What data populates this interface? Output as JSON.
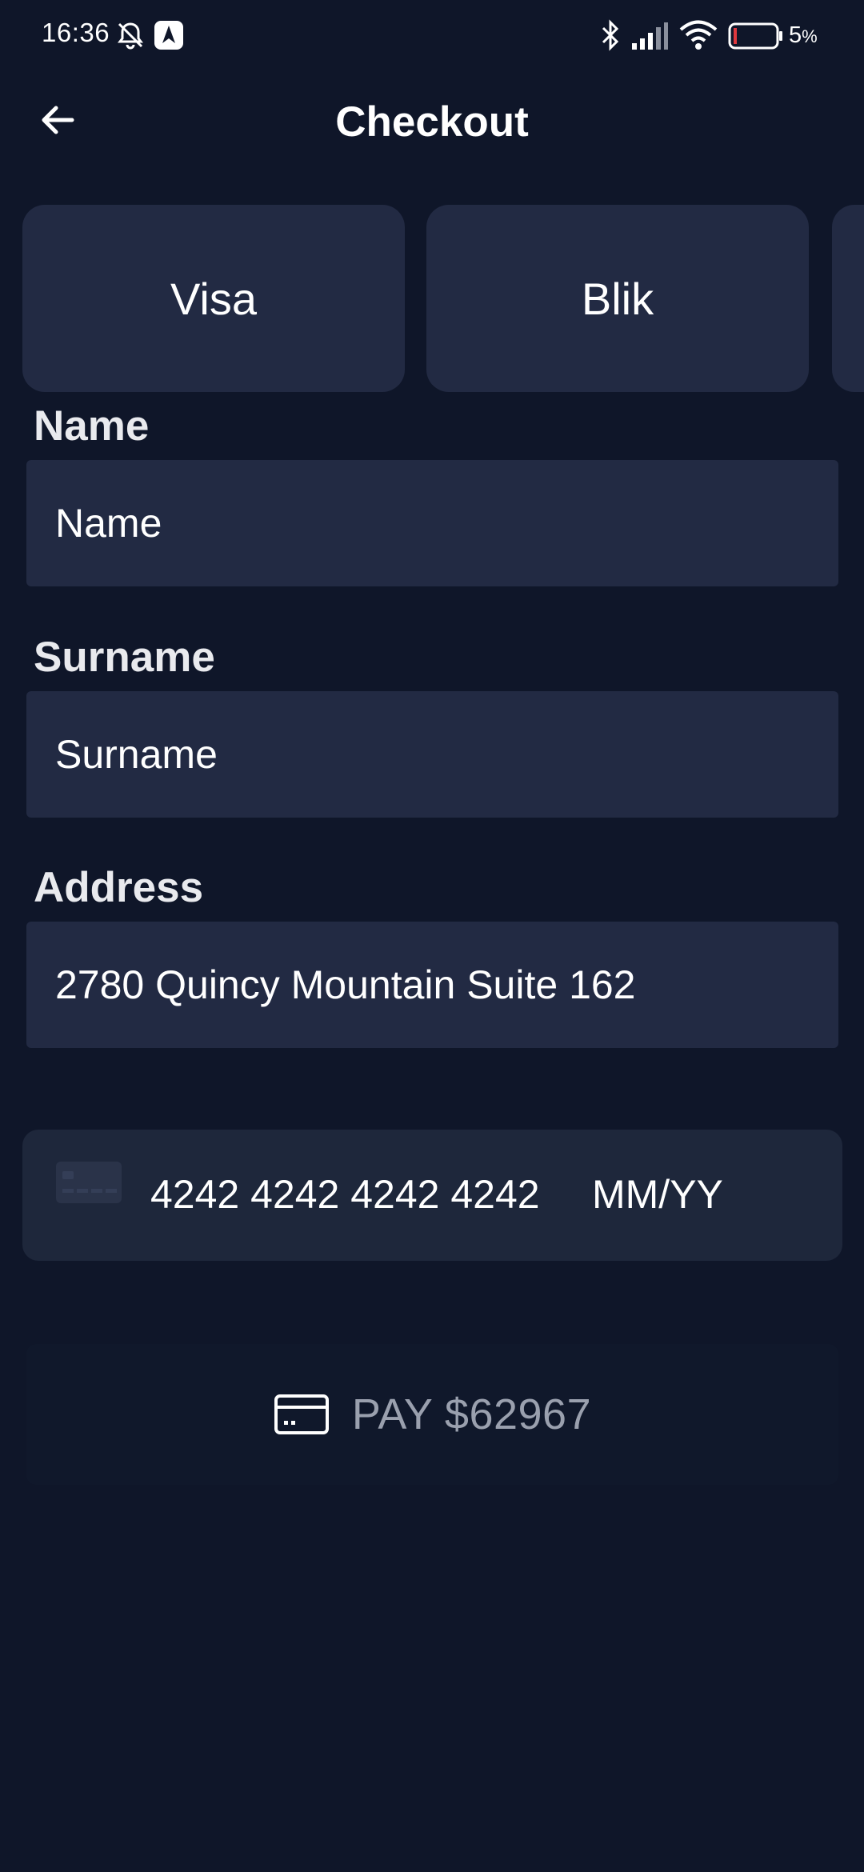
{
  "status_bar": {
    "time": "16:36",
    "battery_percent": "5",
    "battery_unit": "%"
  },
  "header": {
    "title": "Checkout"
  },
  "payment_methods": [
    {
      "label": "Visa"
    },
    {
      "label": "Blik"
    },
    {
      "label": ""
    }
  ],
  "form": {
    "name": {
      "label": "Name",
      "placeholder": "Name",
      "value": ""
    },
    "surname": {
      "label": "Surname",
      "placeholder": "Surname",
      "value": ""
    },
    "address": {
      "label": "Address",
      "value": "2780 Quincy Mountain Suite 162"
    }
  },
  "card": {
    "number": "4242 4242 4242 4242",
    "expiry_placeholder": "MM/YY"
  },
  "pay_button": {
    "label": "PAY $62967"
  },
  "colors": {
    "background": "#0f1629",
    "surface": "#222a43",
    "card_surface": "#1e273b",
    "pay_label": "#9aa0ae"
  },
  "icons": [
    "back-arrow-icon",
    "bell-muted-icon",
    "app-notification-icon",
    "bluetooth-icon",
    "signal-icon",
    "wifi-icon",
    "battery-icon",
    "card-brand-icon",
    "credit-card-icon"
  ]
}
